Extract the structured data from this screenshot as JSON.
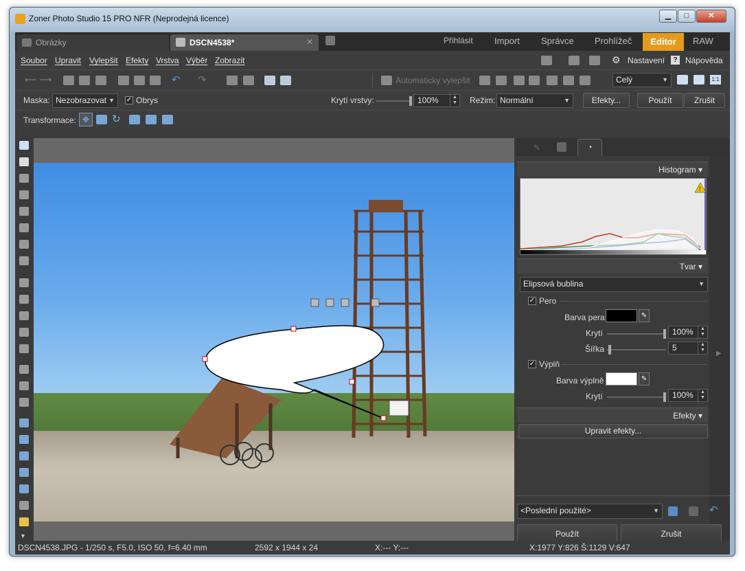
{
  "window": {
    "title": "Zoner Photo Studio 15 PRO NFR (Neprodejná licence)"
  },
  "tabs": {
    "images": "Obrázky",
    "document": "DSCN4538*",
    "login": "Přihlásit",
    "import": "Import",
    "manager": "Správce",
    "viewer": "Prohlížeč",
    "editor": "Editor",
    "raw": "RAW"
  },
  "menu": {
    "file": "Soubor",
    "edit": "Upravit",
    "enhance": "Vylepšit",
    "effects": "Efekty",
    "layer": "Vrstva",
    "selection": "Výběr",
    "view": "Zobrazit",
    "settings": "Nastavení",
    "help": "Nápověda"
  },
  "toolbar1": {
    "auto_enhance": "Automaticky vylepšit",
    "zoom_value": "Celý"
  },
  "toolbar2": {
    "mask_label": "Maska:",
    "mask_value": "Nezobrazovat",
    "outline_label": "Obrys",
    "opacity_label": "Krytí vrstvy:",
    "opacity_value": "100%",
    "mode_label": "Režim:",
    "mode_value": "Normální",
    "effects_button": "Efekty...",
    "apply_button": "Použít",
    "cancel_button": "Zrušit"
  },
  "toolbar3": {
    "transform_label": "Transformace:"
  },
  "panel": {
    "histogram_title": "Histogram",
    "shape_title": "Tvar",
    "shape_value": "Elipsová bublina",
    "pen_label": "Pero",
    "pen_color_label": "Barva pera",
    "pen_opacity_label": "Krytí",
    "pen_opacity_value": "100%",
    "pen_width_label": "Šířka",
    "pen_width_value": "5",
    "fill_label": "Výplň",
    "fill_color_label": "Barva výplně",
    "fill_opacity_label": "Krytí",
    "fill_opacity_value": "100%",
    "effects_title": "Efekty",
    "edit_effects_button": "Upravit efekty...",
    "recent_value": "<Poslední použité>",
    "apply_button": "Použít",
    "cancel_button": "Zrušit",
    "pen_color": "#000000",
    "fill_color": "#ffffff"
  },
  "status": {
    "file_info": "DSCN4538.JPG - 1/250 s, F5.0, ISO 50, f=6.40 mm",
    "dimensions": "2592 x 1944 x 24",
    "cursor": "X:---  Y:---",
    "selection": "X:1977  Y:826  Š:1129  V:647"
  },
  "colors": {
    "editor_tab": "#e49b1d",
    "accent_blue": "#3b86d9"
  }
}
